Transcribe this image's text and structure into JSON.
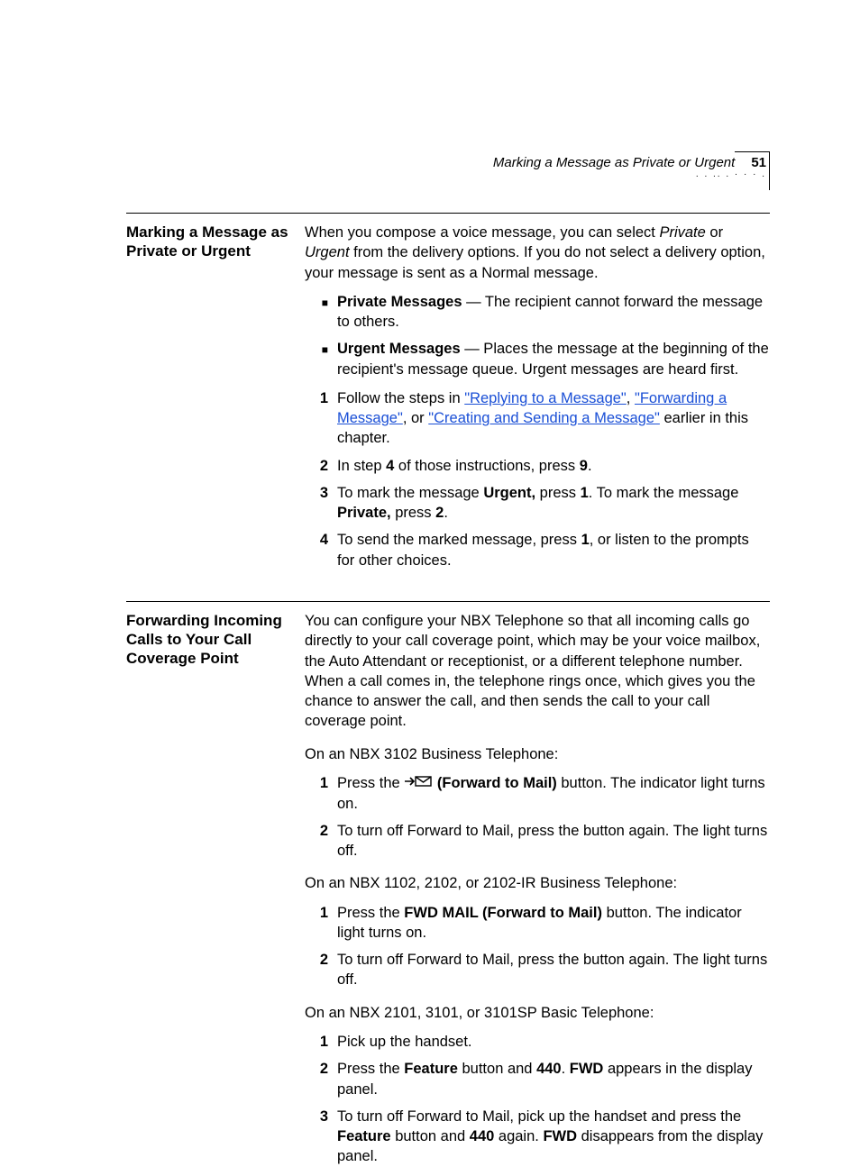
{
  "header": {
    "running_title": "Marking a Message as Private or Urgent",
    "page_number": "51"
  },
  "s1": {
    "heading": "Marking a Message as Private or Urgent",
    "intro_a": "When you compose a voice message, you can select ",
    "intro_private": "Private",
    "intro_or": " or ",
    "intro_urgent": "Urgent",
    "intro_b": " from the delivery options. If you do not select a delivery option, your message is sent as a Normal message.",
    "bul1_a": "Private Messages",
    "bul1_b": " — The recipient cannot forward the message to others.",
    "bul2_a": "Urgent Messages",
    "bul2_b": " — Places the message at the beginning of the recipient's message queue. Urgent messages are heard first.",
    "step1_a": "Follow the steps in ",
    "step1_l1": "\"Replying to a Message\"",
    "step1_b": ", ",
    "step1_l2": "\"Forwarding a Message\"",
    "step1_c": ", or ",
    "step1_l3": "\"Creating and Sending a Message\"",
    "step1_d": " earlier in this chapter.",
    "step2_a": "In step ",
    "step2_b": "4",
    "step2_c": " of those instructions, press ",
    "step2_d": "9",
    "step2_e": ".",
    "step3_a": "To mark the message ",
    "step3_b": "Urgent,",
    "step3_c": " press ",
    "step3_d": "1",
    "step3_e": ". To mark the message ",
    "step3_f": "Private,",
    "step3_g": " press ",
    "step3_h": "2",
    "step3_i": ".",
    "step4_a": "To send the marked message, press ",
    "step4_b": "1",
    "step4_c": ", or listen to the prompts for other choices."
  },
  "s2": {
    "heading": "Forwarding Incoming Calls to Your Call Coverage Point",
    "intro": "You can configure your NBX Telephone so that all incoming calls go directly to your call coverage point, which may be your voice mailbox, the Auto Attendant or receptionist, or a different telephone number. When a call comes in, the telephone rings once, which gives you the chance to answer the call, and then sends the call to your call coverage point.",
    "sub1": "On an NBX 3102 Business Telephone:",
    "sub1_step1_a": "Press the ",
    "sub1_step1_b": " (Forward to Mail)",
    "sub1_step1_c": " button. The indicator light turns on.",
    "sub1_step2": "To turn off Forward to Mail, press the button again. The light turns off.",
    "sub2": "On an NBX 1102, 2102, or 2102-IR Business Telephone:",
    "sub2_step1_a": "Press the ",
    "sub2_step1_b": "FWD MAIL (Forward to Mail)",
    "sub2_step1_c": " button. The indicator light turns on.",
    "sub2_step2": "To turn off Forward to Mail, press the button again. The light turns off.",
    "sub3": "On an NBX 2101, 3101, or 3101SP Basic Telephone:",
    "sub3_step1": "Pick up the handset.",
    "sub3_step2_a": "Press the ",
    "sub3_step2_b": "Feature",
    "sub3_step2_c": " button and ",
    "sub3_step2_d": "440",
    "sub3_step2_e": ". ",
    "sub3_step2_f": "FWD",
    "sub3_step2_g": " appears in the display panel.",
    "sub3_step3_a": "To turn off Forward to Mail, pick up the handset and press the ",
    "sub3_step3_b": "Feature",
    "sub3_step3_c": " button and ",
    "sub3_step3_d": "440",
    "sub3_step3_e": " again. ",
    "sub3_step3_f": "FWD",
    "sub3_step3_g": " disappears from the display panel."
  },
  "markers": {
    "n1": "1",
    "n2": "2",
    "n3": "3",
    "n4": "4",
    "bullet": "■"
  }
}
